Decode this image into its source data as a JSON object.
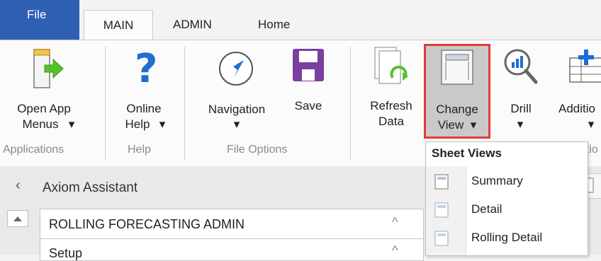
{
  "tabs": {
    "file": "File",
    "main": "MAIN",
    "admin": "ADMIN",
    "home": "Home"
  },
  "ribbon": {
    "open_app_menus": {
      "line1": "Open App",
      "line2": "Menus"
    },
    "online_help": {
      "line1": "Online",
      "line2": "Help"
    },
    "navigation": "Navigation",
    "save": "Save",
    "refresh_data": {
      "line1": "Refresh",
      "line2": "Data"
    },
    "change_view": {
      "line1": "Change",
      "line2": "View"
    },
    "drill": "Drill",
    "additional": "Additio",
    "groups": {
      "applications": "Applications",
      "help": "Help",
      "file_options": "File Options",
      "partial": "ptio"
    },
    "dropdown_arrow": "▾"
  },
  "sheet_views_menu": {
    "title": "Sheet Views",
    "items": [
      {
        "label": "Summary"
      },
      {
        "label": "Detail"
      },
      {
        "label": "Rolling Detail"
      }
    ]
  },
  "assistant": {
    "collapse_glyph": "‹",
    "title": "Axiom Assistant",
    "section_title": "ROLLING FORECASTING ADMIN",
    "section_next": "Setup",
    "collapse_chevron": "^"
  },
  "colors": {
    "file_tab": "#2f5fb3",
    "highlight_border": "#e23b3b",
    "help_blue": "#1e6fd1",
    "save_purple": "#7b3fa0",
    "green_arrow": "#56c22b"
  }
}
